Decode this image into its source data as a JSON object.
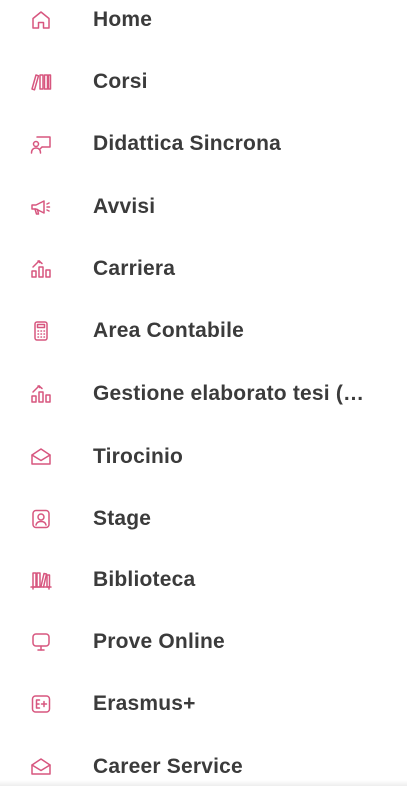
{
  "accent_color": "#d7567f",
  "text_color": "#3b3b3b",
  "menu": {
    "items": [
      {
        "label": "Home",
        "icon": "home-icon"
      },
      {
        "label": "Corsi",
        "icon": "books-icon"
      },
      {
        "label": "Didattica Sincrona",
        "icon": "presenter-board-icon"
      },
      {
        "label": "Avvisi",
        "icon": "megaphone-icon"
      },
      {
        "label": "Carriera",
        "icon": "career-chart-icon"
      },
      {
        "label": "Area Contabile",
        "icon": "calculator-icon"
      },
      {
        "label": "Gestione elaborato tesi (…",
        "icon": "career-chart-icon"
      },
      {
        "label": "Tirocinio",
        "icon": "envelope-icon"
      },
      {
        "label": "Stage",
        "icon": "user-badge-icon"
      },
      {
        "label": "Biblioteca",
        "icon": "bookshelf-icon"
      },
      {
        "label": "Prove Online",
        "icon": "monitor-icon"
      },
      {
        "label": "Erasmus+",
        "icon": "erasmus-badge-icon"
      },
      {
        "label": "Career Service",
        "icon": "envelope-icon"
      }
    ]
  }
}
